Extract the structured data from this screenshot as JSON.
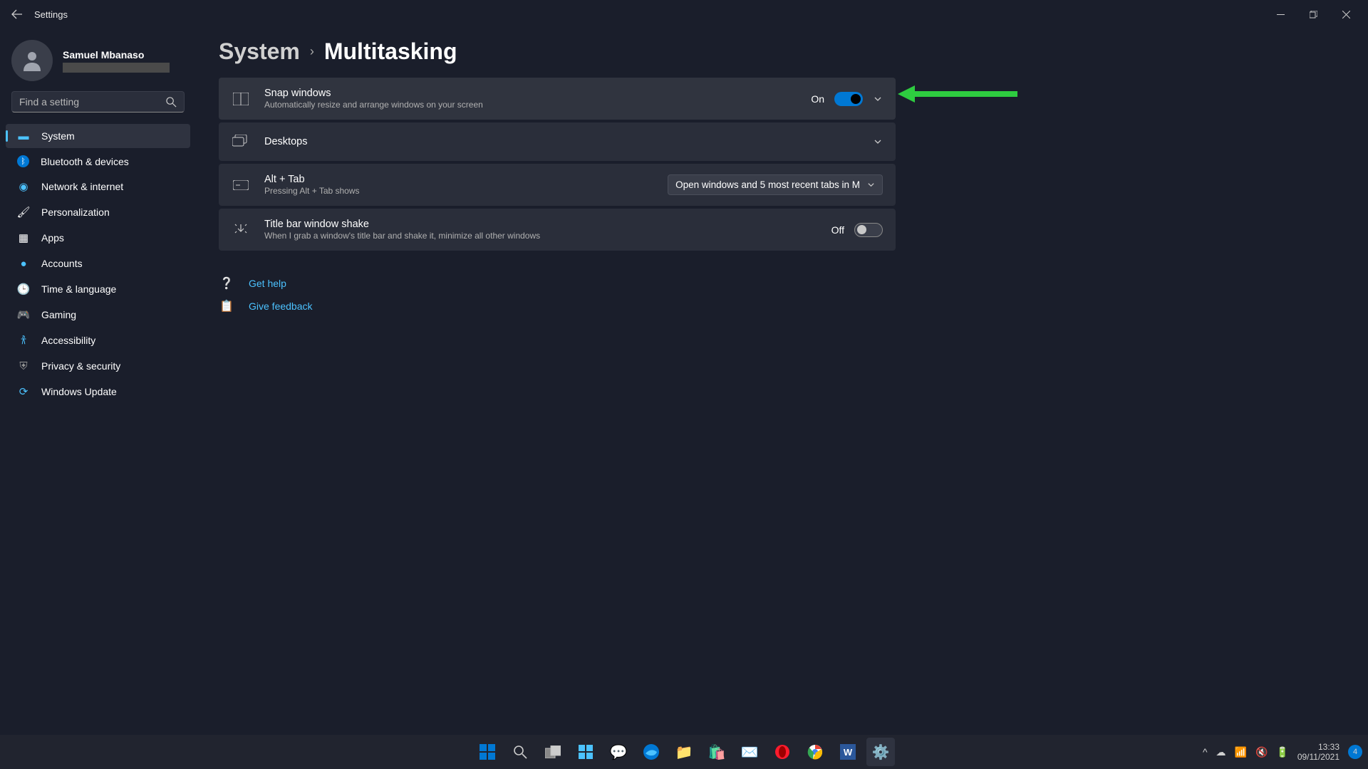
{
  "titlebar": {
    "title": "Settings"
  },
  "profile": {
    "name": "Samuel Mbanaso"
  },
  "search": {
    "placeholder": "Find a setting"
  },
  "nav": {
    "items": [
      {
        "label": "System",
        "icon": "🖥️"
      },
      {
        "label": "Bluetooth & devices",
        "icon": "bt"
      },
      {
        "label": "Network & internet",
        "icon": "📶"
      },
      {
        "label": "Personalization",
        "icon": "🖌️"
      },
      {
        "label": "Apps",
        "icon": "▦"
      },
      {
        "label": "Accounts",
        "icon": "👤"
      },
      {
        "label": "Time & language",
        "icon": "🌐"
      },
      {
        "label": "Gaming",
        "icon": "🎮"
      },
      {
        "label": "Accessibility",
        "icon": "♿"
      },
      {
        "label": "Privacy & security",
        "icon": "🛡️"
      },
      {
        "label": "Windows Update",
        "icon": "🔄"
      }
    ]
  },
  "breadcrumb": {
    "parent": "System",
    "current": "Multitasking"
  },
  "settings": {
    "snap": {
      "title": "Snap windows",
      "sub": "Automatically resize and arrange windows on your screen",
      "state": "On"
    },
    "desktops": {
      "title": "Desktops"
    },
    "alttab": {
      "title": "Alt + Tab",
      "sub": "Pressing Alt + Tab shows",
      "selected": "Open windows and 5 most recent tabs in M"
    },
    "shake": {
      "title": "Title bar window shake",
      "sub": "When I grab a window's title bar and shake it, minimize all other windows",
      "state": "Off"
    }
  },
  "help": {
    "get_help": "Get help",
    "feedback": "Give feedback"
  },
  "tray": {
    "time": "13:33",
    "date": "09/11/2021",
    "notif_count": "4"
  }
}
